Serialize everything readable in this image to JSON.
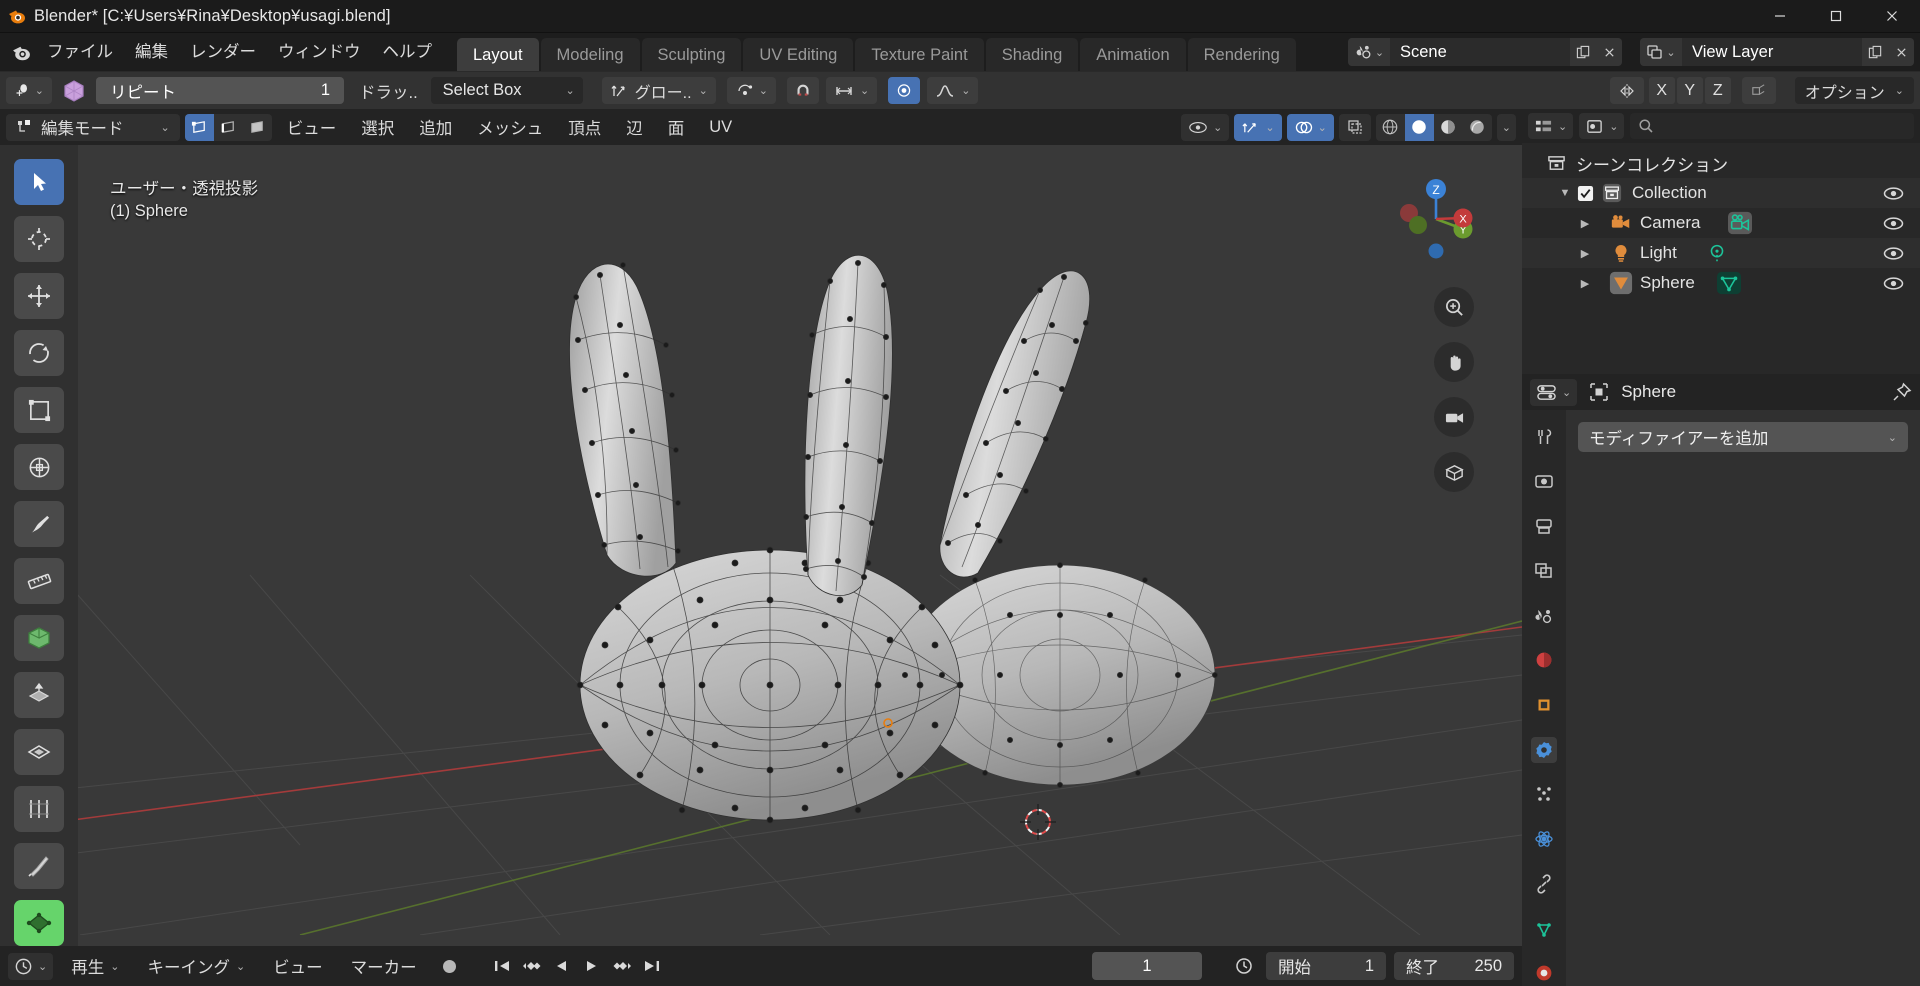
{
  "window": {
    "title": "Blender* [C:\\Users\\Rina\\Desktop\\usagi.blend]",
    "title_display": "Blender* [C:¥Users¥Rina¥Desktop¥usagi.blend]",
    "minimize": "—",
    "maximize": "▢",
    "close": "✕",
    "app_icon": "blender-logo-icon"
  },
  "topbar": {
    "menus": [
      "ファイル",
      "編集",
      "レンダー",
      "ウィンドウ",
      "ヘルプ"
    ],
    "workspaces": [
      {
        "label": "Layout",
        "active": true
      },
      {
        "label": "Modeling",
        "active": false
      },
      {
        "label": "Sculpting",
        "active": false
      },
      {
        "label": "UV Editing",
        "active": false
      },
      {
        "label": "Texture Paint",
        "active": false
      },
      {
        "label": "Shading",
        "active": false
      },
      {
        "label": "Animation",
        "active": false
      },
      {
        "label": "Rendering",
        "active": false
      }
    ],
    "scene": {
      "name": "Scene",
      "icon": "scene-icon",
      "new_btn": "copy-icon",
      "unlink_btn": "x-icon"
    },
    "viewlayer": {
      "name": "View Layer",
      "icon": "viewlayer-icon",
      "new_btn": "copy-icon",
      "unlink_btn": "x-icon"
    }
  },
  "toolsettings": {
    "active_tool_icon": "tweak-tool-icon",
    "object_icon": "mesh-data-icon",
    "repeat_label": "リピート",
    "repeat_value": "1",
    "drag_label": "ドラッ..",
    "select_mode": "Select Box",
    "transform_orientation_icon": "orientation-icon",
    "transform_orientation": "グロー..",
    "pivot_icon": "pivot-icon",
    "snap_magnet_icon": "magnet-icon",
    "snap_icon": "snap-icon",
    "proportional_icon": "proportional-edit-icon",
    "falloff_icon": "falloff-curve-icon",
    "mirror_label": "mirror-icon",
    "axes": [
      "X",
      "Y",
      "Z"
    ],
    "options_label": "オプション"
  },
  "viewport": {
    "mode": "編集モード",
    "mode_icon": "edit-mode-icon",
    "select_modes": [
      {
        "name": "vertex-select-icon",
        "on": true
      },
      {
        "name": "edge-select-icon",
        "on": false
      },
      {
        "name": "face-select-icon",
        "on": false
      }
    ],
    "menus": [
      "ビュー",
      "選択",
      "追加",
      "メッシュ",
      "頂点",
      "辺",
      "面",
      "UV"
    ],
    "overlay_icons": [
      "visibility-icon",
      "gizmo-icon",
      "overlays-icon",
      "xray-icon"
    ],
    "shading_modes": [
      {
        "name": "wireframe-shading-icon",
        "on": false
      },
      {
        "name": "solid-shading-icon",
        "on": true
      },
      {
        "name": "material-shading-icon",
        "on": false
      },
      {
        "name": "rendered-shading-icon",
        "on": false
      }
    ],
    "info_line1": "ユーザー・透視投影",
    "info_line2": "(1) Sphere",
    "gizmo_axes": [
      "Z",
      "Y",
      "X"
    ],
    "nav_buttons": [
      "zoom-icon",
      "pan-hand-icon",
      "camera-view-icon",
      "toggle-ortho-icon"
    ],
    "tools": [
      {
        "name": "tweak-tool-icon",
        "selected": true
      },
      {
        "name": "cursor-tool-icon",
        "selected": false
      },
      {
        "name": "move-tool-icon",
        "selected": false
      },
      {
        "name": "rotate-tool-icon",
        "selected": false
      },
      {
        "name": "scale-tool-icon",
        "selected": false
      },
      {
        "name": "transform-tool-icon",
        "selected": false
      },
      {
        "name": "annotate-tool-icon",
        "selected": false
      },
      {
        "name": "measure-tool-icon",
        "selected": false
      },
      {
        "name": "add-cube-tool-icon",
        "selected": false
      },
      {
        "name": "extrude-tool-icon",
        "selected": false
      },
      {
        "name": "inset-faces-tool-icon",
        "selected": false
      },
      {
        "name": "loop-cut-tool-icon",
        "selected": false
      },
      {
        "name": "knife-tool-icon",
        "selected": false
      },
      {
        "name": "poly-build-tool-icon",
        "selected": false
      }
    ]
  },
  "outliner": {
    "display_mode_icon": "outliner-display-icon",
    "filter_icon": "filter-icon",
    "search_placeholder": "",
    "search_icon": "search-icon",
    "root": {
      "label": "シーンコレクション",
      "icon": "scene-collection-icon"
    },
    "items": [
      {
        "label": "Collection",
        "icon": "collection-icon",
        "indent": 1,
        "expanded": true,
        "checkbox": true,
        "eye": "eye-icon",
        "badge": null
      },
      {
        "label": "Camera",
        "icon": "camera-object-icon",
        "indent": 2,
        "expanded": false,
        "checkbox": false,
        "eye": "eye-icon",
        "badge": "camera-data-icon"
      },
      {
        "label": "Light",
        "icon": "light-object-icon",
        "indent": 2,
        "expanded": false,
        "checkbox": false,
        "eye": "eye-icon",
        "badge": "light-data-icon"
      },
      {
        "label": "Sphere",
        "icon": "mesh-object-icon",
        "indent": 2,
        "expanded": false,
        "checkbox": false,
        "eye": "eye-icon",
        "badge": "mesh-data-icon"
      }
    ]
  },
  "properties": {
    "editor_icon": "properties-editor-icon",
    "breadcrumb_icon": "object-icon",
    "breadcrumb": "Sphere",
    "pin_icon": "pin-icon",
    "tabs": [
      {
        "name": "tool-tab-icon",
        "active": false
      },
      {
        "name": "render-tab-icon",
        "active": false
      },
      {
        "name": "output-tab-icon",
        "active": false
      },
      {
        "name": "viewlayer-tab-icon",
        "active": false
      },
      {
        "name": "scene-tab-icon",
        "active": false
      },
      {
        "name": "world-tab-icon",
        "active": false
      },
      {
        "name": "object-tab-icon",
        "active": false
      },
      {
        "name": "modifier-tab-icon",
        "active": true
      },
      {
        "name": "particles-tab-icon",
        "active": false
      },
      {
        "name": "physics-tab-icon",
        "active": false
      },
      {
        "name": "constraints-tab-icon",
        "active": false
      },
      {
        "name": "data-tab-icon",
        "active": false
      },
      {
        "name": "material-tab-icon",
        "active": false
      }
    ],
    "add_modifier": "モディファイアーを追加"
  },
  "timeline": {
    "editor_icon": "timeline-editor-icon",
    "menus": [
      "再生",
      "キーイング",
      "ビュー",
      "マーカー"
    ],
    "record_icon": "record-icon",
    "transport": [
      "jump-start-icon",
      "prev-keyframe-icon",
      "play-reverse-icon",
      "play-icon",
      "next-keyframe-icon",
      "jump-end-icon"
    ],
    "current_frame": "1",
    "clock_icon": "clock-icon",
    "start_label": "開始",
    "start_value": "1",
    "end_label": "終了",
    "end_value": "250"
  },
  "colors": {
    "accent_blue": "#4772b3",
    "orange": "#e87d0d",
    "panel_bg": "#303030",
    "viewport_bg": "#393939",
    "green": "#66d46b",
    "teal": "#1aa67f"
  }
}
